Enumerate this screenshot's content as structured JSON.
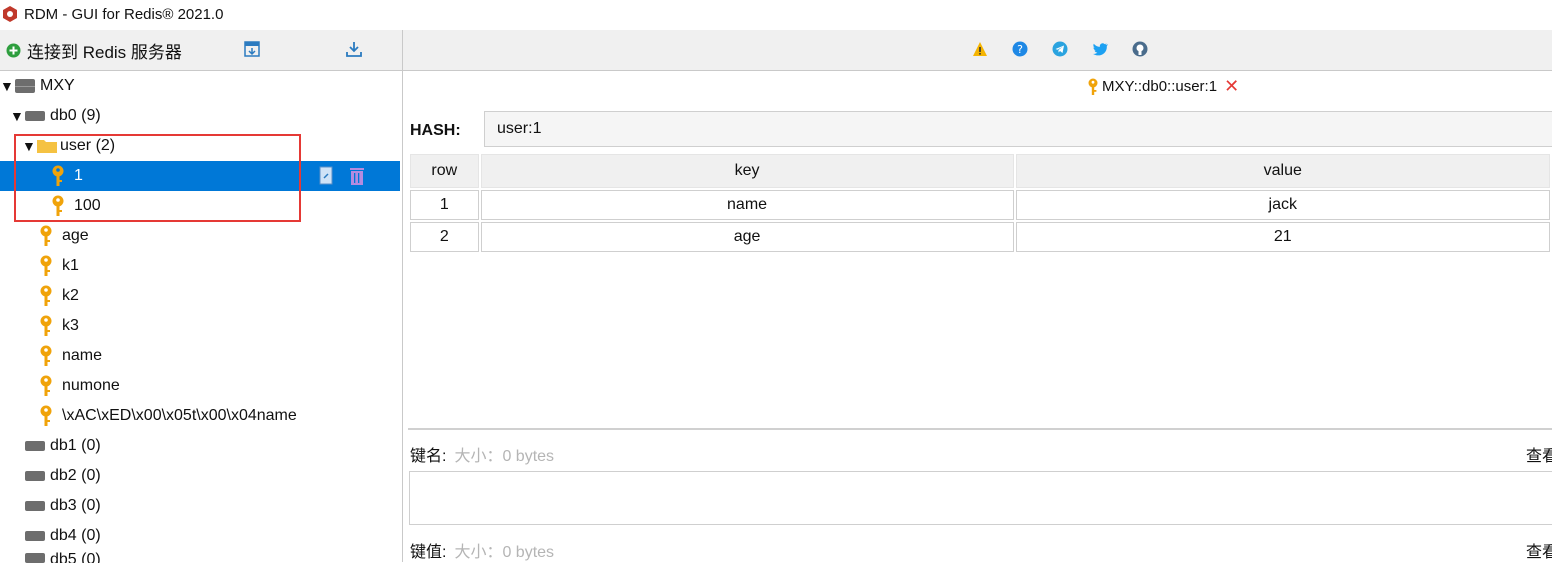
{
  "window": {
    "title": "RDM - GUI for Redis® 2021.0"
  },
  "sidebar": {
    "connect_label": "连接到 Redis 服务器",
    "tree": {
      "server": "MXY",
      "db0": "db0  (9)",
      "folder": "user (2)",
      "folder_keys": [
        "1",
        "100"
      ],
      "keys": [
        "age",
        "k1",
        "k2",
        "k3",
        "name",
        "numone",
        "\\xAC\\xED\\x00\\x05t\\x00\\x04name"
      ],
      "dbs": [
        "db1  (0)",
        "db2  (0)",
        "db3  (0)",
        "db4  (0)",
        "db5  (0)"
      ]
    }
  },
  "main": {
    "tab_label": "MXY::db0::user:1",
    "hash_label": "HASH:",
    "hash_value": "user:1",
    "table": {
      "headers": [
        "row",
        "key",
        "value"
      ],
      "rows": [
        [
          "1",
          "name",
          "jack"
        ],
        [
          "2",
          "age",
          "21"
        ]
      ]
    },
    "key_name_label": "键名:",
    "key_size": "大小：0 bytes",
    "view_label": "查看",
    "key_value_label": "键值:",
    "value_size": "大小：0 bytes",
    "view_label_2": "查看"
  },
  "colors": {
    "selection": "#0078d7",
    "highlight": "#e53935",
    "key_icon": "#f0a30a"
  }
}
